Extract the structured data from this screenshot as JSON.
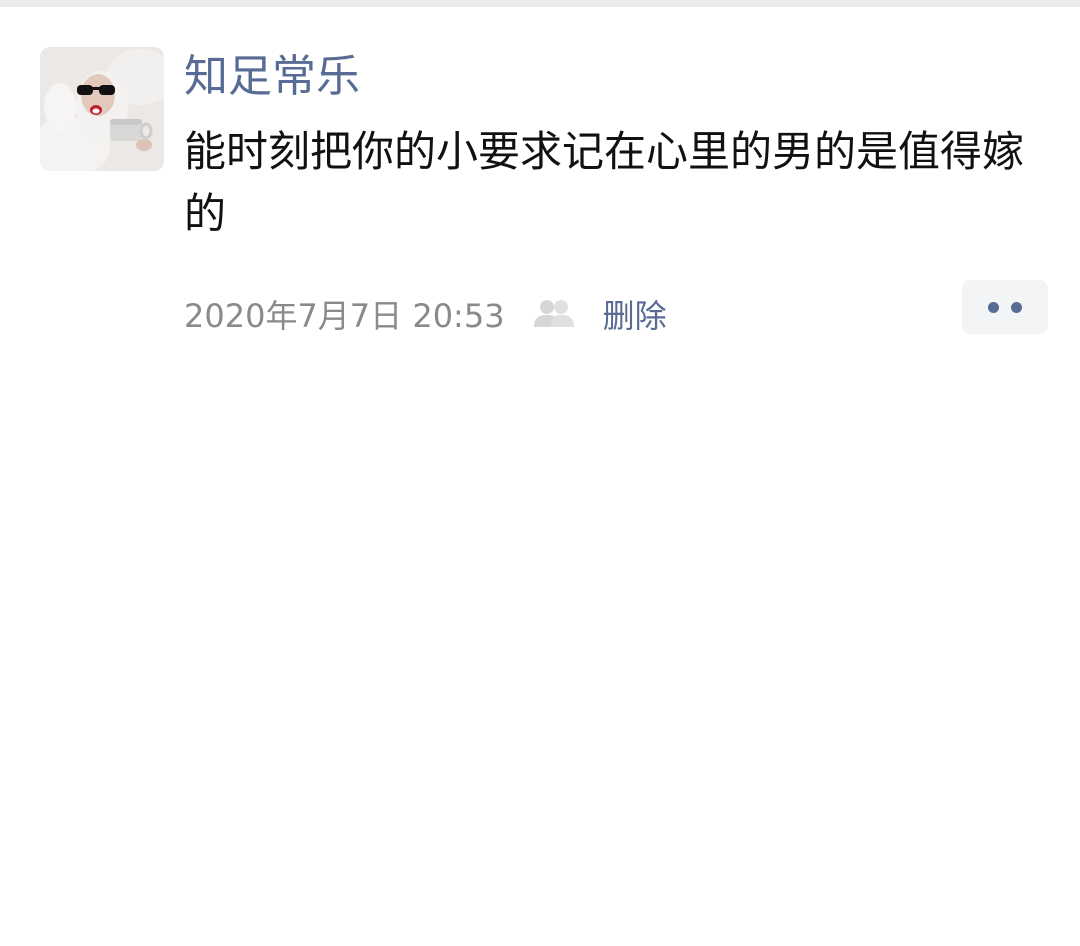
{
  "post": {
    "username": "知足常乐",
    "content": "能时刻把你的小要求记在心里的男的是值得嫁的",
    "timestamp": "2020年7月7日 20:53",
    "visibility_icon": "two-people-icon",
    "delete_label": "删除",
    "more_icon": "more-dots-icon"
  },
  "colors": {
    "link": "#576b95",
    "meta_text": "#8a8a8a",
    "body_text": "#111111",
    "more_bg": "#f3f4f6"
  }
}
